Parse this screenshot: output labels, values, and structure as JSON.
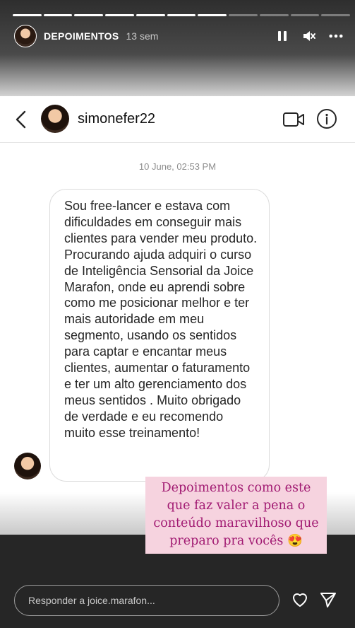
{
  "story": {
    "progress": {
      "total": 11,
      "completed": 7
    },
    "account": "DEPOIMENTOS",
    "posted": "13 sem",
    "icons": [
      "pause-icon",
      "mute-icon",
      "more-options-icon"
    ]
  },
  "dm": {
    "username": "simonefer22",
    "timestamp": "10 June, 02:53 PM",
    "message": "Sou free-lancer e estava com dificuldades em conseguir mais clientes para vender meu produto. Procurando ajuda adquiri o curso de Inteligência Sensorial da Joice Marafon, onde eu aprendi sobre como me posicionar melhor e ter mais autoridade em meu segmento, usando os sentidos para captar e encantar meus clientes, aumentar o faturamento e ter um alto gerenciamento dos meus sentidos . Muito obrigado de verdade e eu recomendo muito esse treinamento!",
    "icons": [
      "back-chevron-icon",
      "video-call-icon",
      "info-icon"
    ]
  },
  "caption": {
    "text": "Depoimentos como este que faz valer a pena o conteúdo maravilhoso que preparo pra vocês 😍",
    "bg_color": "#f6d3df",
    "text_color": "#a11a72"
  },
  "reply": {
    "placeholder": "Responder a joice.marafon...",
    "icons": [
      "heart-icon",
      "send-icon"
    ]
  }
}
